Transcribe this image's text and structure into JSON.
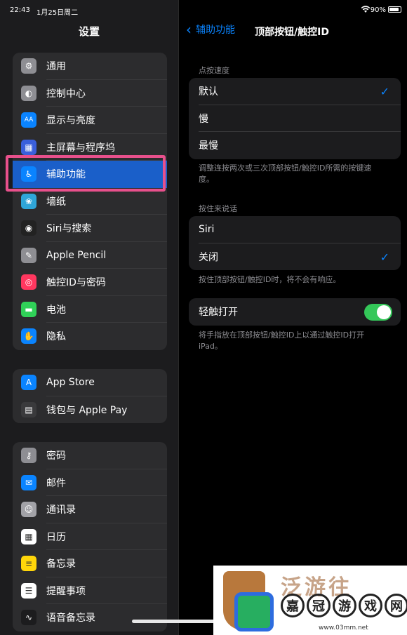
{
  "status": {
    "time": "22:43",
    "date": "1月25日周二",
    "battery": "90%"
  },
  "sidebar": {
    "title": "设置",
    "groups": [
      {
        "items": [
          {
            "label": "通用",
            "icon": "gear-icon",
            "color": "#8e8e93"
          },
          {
            "label": "控制中心",
            "icon": "toggles-icon",
            "color": "#8e8e93"
          },
          {
            "label": "显示与亮度",
            "icon": "text-size-icon",
            "color": "#0a84ff"
          },
          {
            "label": "主屏幕与程序坞",
            "icon": "grid-icon",
            "color": "#3a5fdc"
          },
          {
            "label": "辅助功能",
            "icon": "accessibility-icon",
            "color": "#0a84ff",
            "selected": true
          },
          {
            "label": "墙纸",
            "icon": "flower-icon",
            "color": "#2fa6d8"
          },
          {
            "label": "Siri与搜索",
            "icon": "siri-icon",
            "color": "#222222"
          },
          {
            "label": "Apple Pencil",
            "icon": "pencil-icon",
            "color": "#8e8e93"
          },
          {
            "label": "触控ID与密码",
            "icon": "fingerprint-icon",
            "color": "#ff375f"
          },
          {
            "label": "电池",
            "icon": "battery-icon",
            "color": "#30d158"
          },
          {
            "label": "隐私",
            "icon": "hand-icon",
            "color": "#0a84ff"
          }
        ]
      },
      {
        "items": [
          {
            "label": "App Store",
            "icon": "appstore-icon",
            "color": "#0a84ff"
          },
          {
            "label": "钱包与 Apple Pay",
            "icon": "wallet-icon",
            "color": "#3a3a3c"
          }
        ]
      },
      {
        "items": [
          {
            "label": "密码",
            "icon": "key-icon",
            "color": "#8e8e93"
          },
          {
            "label": "邮件",
            "icon": "mail-icon",
            "color": "#0a84ff"
          },
          {
            "label": "通讯录",
            "icon": "contacts-icon",
            "color": "#a2a2a7"
          },
          {
            "label": "日历",
            "icon": "calendar-icon",
            "color": "#ffffff"
          },
          {
            "label": "备忘录",
            "icon": "notes-icon",
            "color": "#ffd60a"
          },
          {
            "label": "提醒事项",
            "icon": "reminders-icon",
            "color": "#ffffff"
          },
          {
            "label": "语音备忘录",
            "icon": "voice-memo-icon",
            "color": "#1c1c1e"
          }
        ]
      }
    ]
  },
  "detail": {
    "back_label": "辅助功能",
    "title": "顶部按钮/触控ID",
    "click_speed": {
      "header": "点按速度",
      "options": [
        {
          "label": "默认",
          "checked": true
        },
        {
          "label": "慢",
          "checked": false
        },
        {
          "label": "最慢",
          "checked": false
        }
      ],
      "footer": "调整连按两次或三次顶部按钮/触控ID所需的按键速度。"
    },
    "press_to_speak": {
      "header": "按住来说话",
      "options": [
        {
          "label": "Siri",
          "checked": false
        },
        {
          "label": "关闭",
          "checked": true
        }
      ],
      "footer": "按住顶部按钮/触控ID时，将不会有响应。"
    },
    "rest_to_open": {
      "label": "轻触打开",
      "enabled": true,
      "footer": "将手指放在顶部按钮/触控ID上以通过触控ID打开iPad。"
    }
  },
  "watermark": {
    "top": "泛游往",
    "chars": [
      "嘉",
      "冠",
      "游",
      "戏",
      "网"
    ],
    "url": "www.03mm.net"
  }
}
